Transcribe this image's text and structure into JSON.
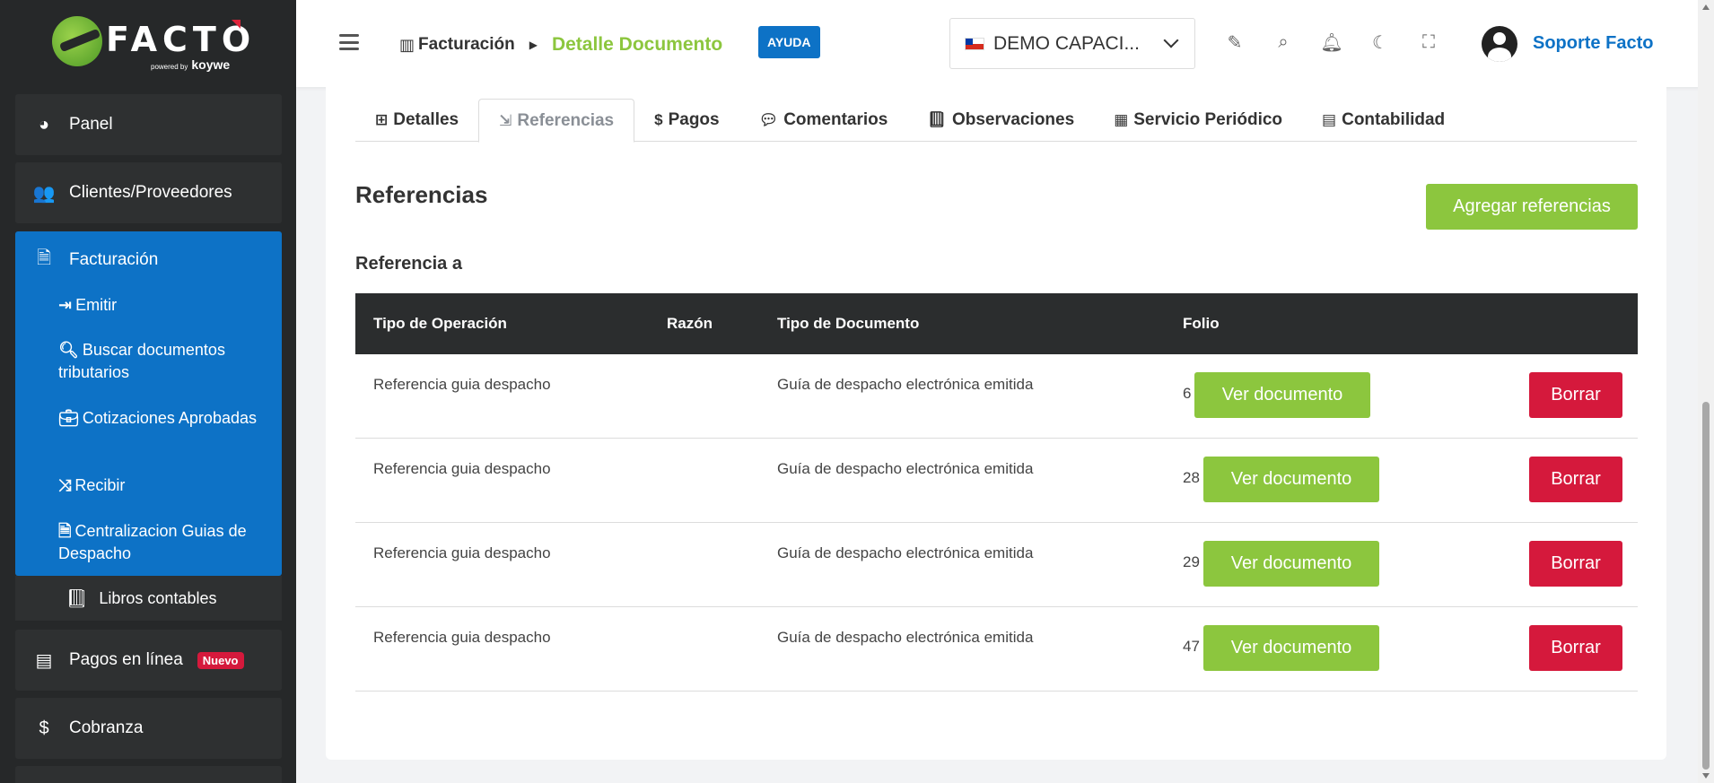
{
  "brand": {
    "name": "FACTO",
    "powered": "powered by",
    "sub": "koywe"
  },
  "sidebar": {
    "items": [
      {
        "label": "Panel",
        "icon": "pie-chart-icon"
      },
      {
        "label": "Clientes/Proveedores",
        "icon": "users-icon"
      },
      {
        "label": "Facturación",
        "icon": "file-icon"
      },
      {
        "label": "Libros contables",
        "icon": "book-icon"
      },
      {
        "label": "Pagos en línea",
        "icon": "money-check-icon",
        "badge": "Nuevo"
      },
      {
        "label": "Cobranza",
        "icon": "dollar-icon"
      }
    ],
    "sub_items": [
      {
        "label": "Emitir",
        "icon": "sign-out-icon"
      },
      {
        "label": "Buscar documentos tributarios",
        "icon": "search-icon"
      },
      {
        "label": "Cotizaciones Aprobadas",
        "icon": "briefcase-icon"
      },
      {
        "label": "Recibir",
        "icon": "shuffle-icon"
      },
      {
        "label": "Centralizacion Guias de Despacho",
        "icon": "document-icon"
      }
    ]
  },
  "header": {
    "breadcrumb_root": "Facturación",
    "breadcrumb_current": "Detalle Documento",
    "help": "AYUDA",
    "company": "DEMO CAPACI...",
    "user": "Soporte Facto"
  },
  "tabs": [
    {
      "label": "Detalles",
      "icon": "table-icon"
    },
    {
      "label": "Referencias",
      "icon": "sign-in-icon"
    },
    {
      "label": "Pagos",
      "icon": "dollar-icon"
    },
    {
      "label": "Comentarios",
      "icon": "comments-icon"
    },
    {
      "label": "Observaciones",
      "icon": "book-icon"
    },
    {
      "label": "Servicio Periódico",
      "icon": "calendar-icon"
    },
    {
      "label": "Contabilidad",
      "icon": "calculator-icon"
    }
  ],
  "content": {
    "title": "Referencias",
    "add_button": "Agregar referencias",
    "subtitle": "Referencia a",
    "columns": [
      "Tipo de Operación",
      "Razón",
      "Tipo de Documento",
      "Folio"
    ],
    "rows": [
      {
        "operacion": "Referencia guia despacho",
        "razon": "",
        "documento": "Guía de despacho electrónica emitida",
        "folio": "6",
        "ver": "Ver documento",
        "borrar": "Borrar"
      },
      {
        "operacion": "Referencia guia despacho",
        "razon": "",
        "documento": "Guía de despacho electrónica emitida",
        "folio": "28",
        "ver": "Ver documento",
        "borrar": "Borrar"
      },
      {
        "operacion": "Referencia guia despacho",
        "razon": "",
        "documento": "Guía de despacho electrónica emitida",
        "folio": "29",
        "ver": "Ver documento",
        "borrar": "Borrar"
      },
      {
        "operacion": "Referencia guia despacho",
        "razon": "",
        "documento": "Guía de despacho electrónica emitida",
        "folio": "47",
        "ver": "Ver documento",
        "borrar": "Borrar"
      }
    ]
  },
  "colors": {
    "accent_green": "#8cc63e",
    "accent_blue": "#0d72c6",
    "danger": "#d5193c",
    "sidebar_bg": "#262829"
  }
}
